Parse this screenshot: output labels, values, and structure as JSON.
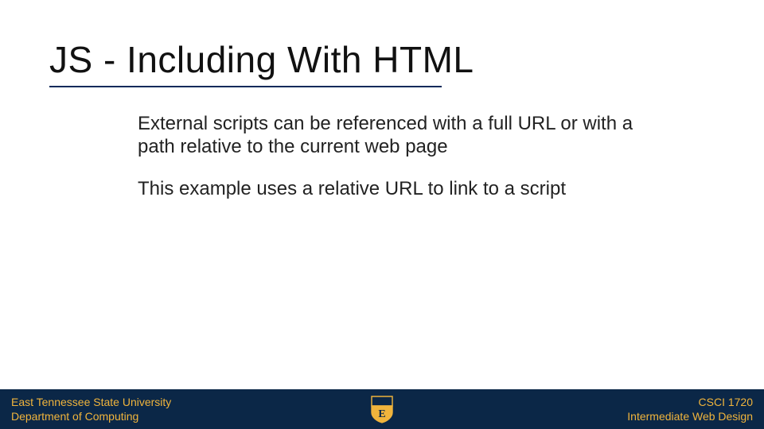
{
  "title": "JS - Including With HTML",
  "body": {
    "p1": "External scripts can be referenced with a full URL or with a path relative to the current web page",
    "p2": "This example uses a relative URL to link to a script"
  },
  "footer": {
    "left": {
      "line1": "East Tennessee State University",
      "line2": "Department of Computing"
    },
    "right": {
      "line1": "CSCI 1720",
      "line2": "Intermediate Web Design"
    },
    "logo_letter": "E"
  },
  "colors": {
    "accent": "#0a2a5a",
    "footer_bg": "#0b2747",
    "gold": "#f0b43c"
  }
}
